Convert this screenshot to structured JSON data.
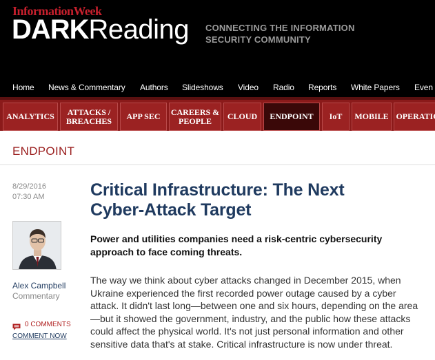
{
  "header": {
    "brand_small": "InformationWeek",
    "brand_main_bold": "DARK",
    "brand_main_light": "Reading",
    "tagline_line1": "CONNECTING THE INFORMATION",
    "tagline_line2": "SECURITY COMMUNITY"
  },
  "topnav": {
    "items": [
      "Home",
      "News & Commentary",
      "Authors",
      "Slideshows",
      "Video",
      "Radio",
      "Reports",
      "White Papers",
      "Even"
    ]
  },
  "categories": {
    "items": [
      {
        "line1": "ANALYTICS",
        "line2": ""
      },
      {
        "line1": "ATTACKS /",
        "line2": "BREACHES"
      },
      {
        "line1": "APP SEC",
        "line2": ""
      },
      {
        "line1": "CAREERS &",
        "line2": "PEOPLE"
      },
      {
        "line1": "CLOUD",
        "line2": ""
      },
      {
        "line1": "ENDPOINT",
        "line2": ""
      },
      {
        "line1": "IoT",
        "line2": ""
      },
      {
        "line1": "MOBILE",
        "line2": ""
      },
      {
        "line1": "OPERATIO",
        "line2": ""
      }
    ],
    "active": "ENDPOINT"
  },
  "section": {
    "label": "ENDPOINT"
  },
  "article": {
    "date": "8/29/2016",
    "time": "07:30 AM",
    "headline_line1": "Critical Infrastructure: The Next",
    "headline_line2": "Cyber-Attack Target",
    "deck": "Power and utilities companies need a risk-centric cybersecurity approach to face coming threats.",
    "body": "The way we think about cyber attacks changed in December 2015, when Ukraine experienced the first recorded power outage caused by a cyber attack. It didn't last long—between one and six hours, depending on the area—but it showed the government, industry, and the public how these attacks could affect the physical world. It's not just personal information and other sensitive data that's at stake. Critical infrastructure is now under threat."
  },
  "author": {
    "name": "Alex Campbell",
    "role": "Commentary"
  },
  "comments": {
    "count_label": "0 COMMENTS",
    "cta_label": "COMMENT NOW"
  },
  "colors": {
    "masthead_bg": "#000000",
    "category_bar": "#8b1a1a",
    "category_active": "#3a0808",
    "headline": "#1f3a5f",
    "section_label": "#9b2020"
  },
  "icons": {
    "comment": "comment-icon",
    "author_photo": "avatar"
  }
}
